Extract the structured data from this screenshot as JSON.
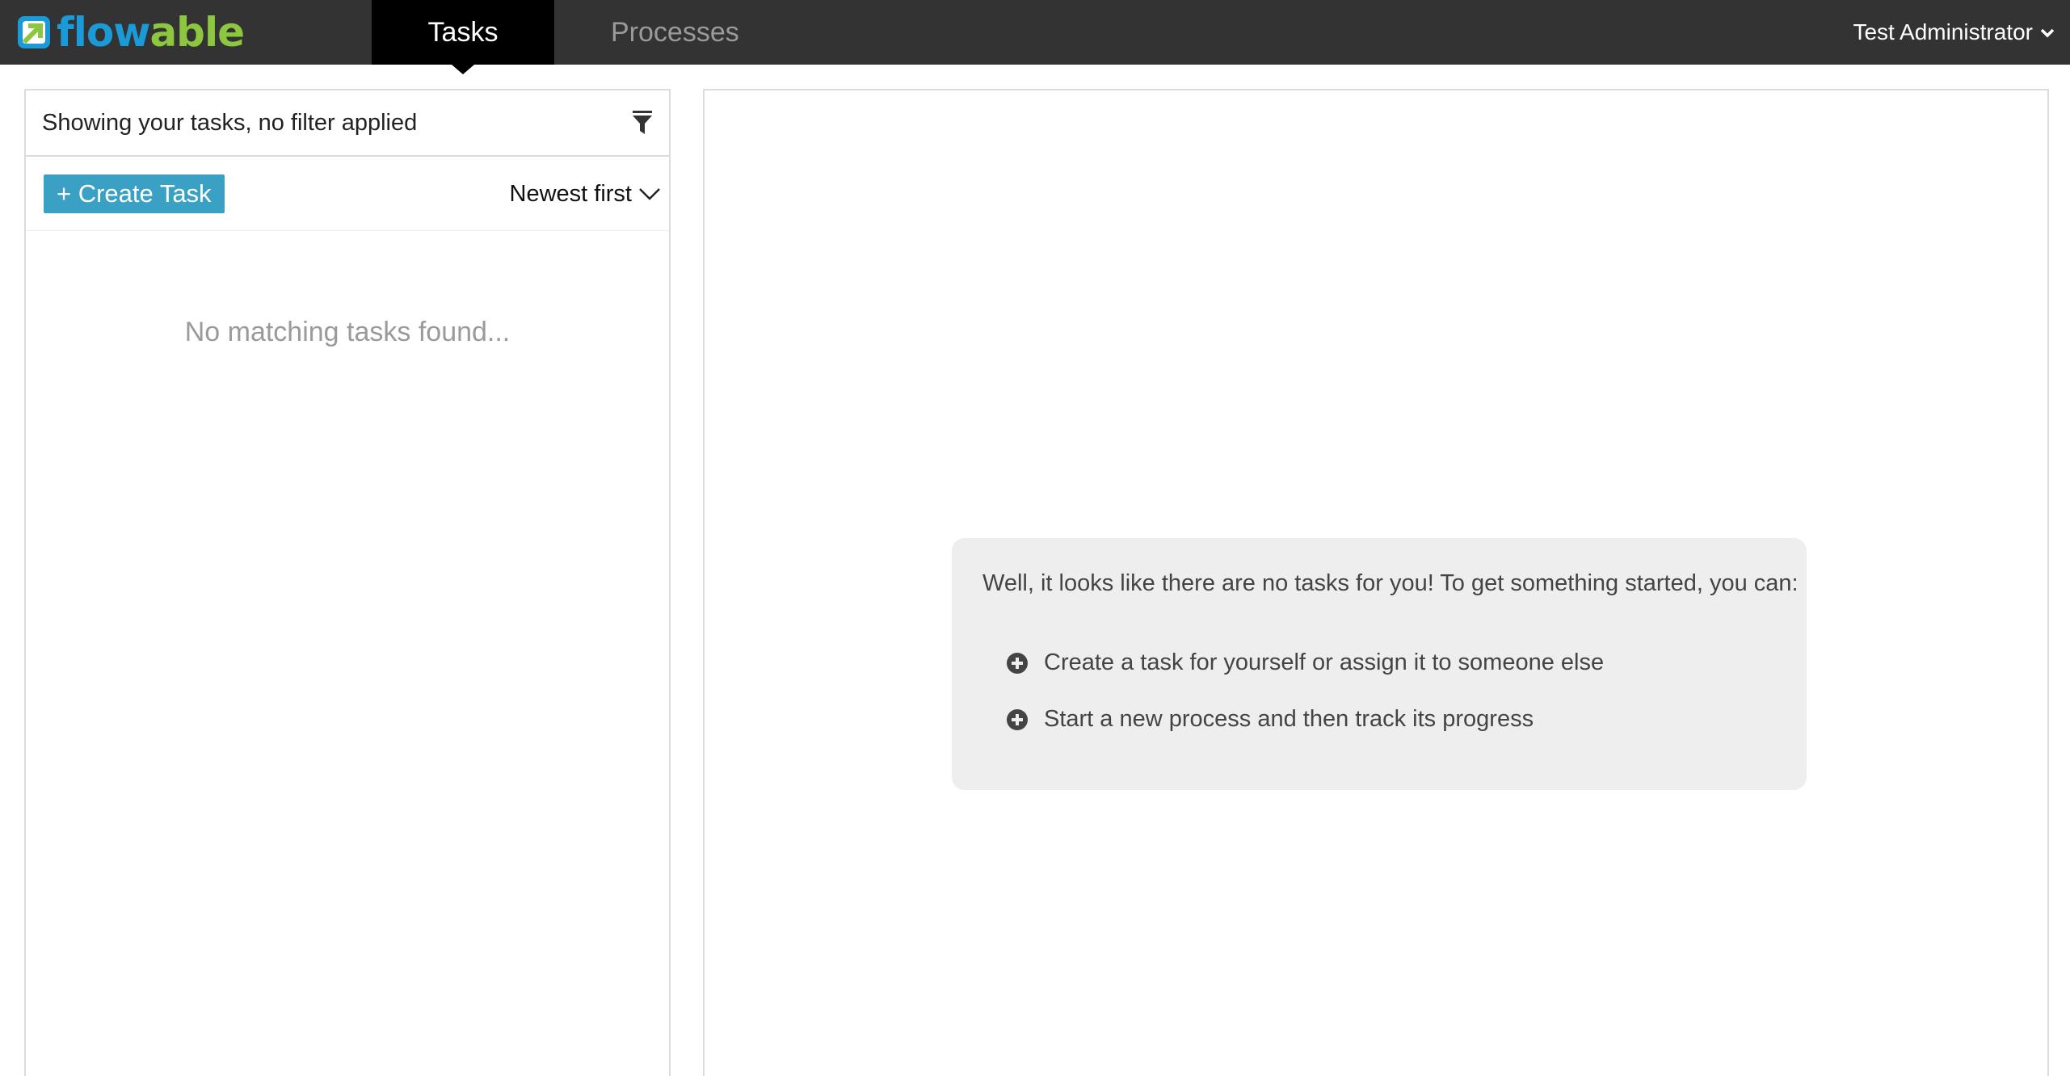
{
  "app": {
    "logo_text_part1": "flow",
    "logo_text_part2": "able",
    "logo_icon": "flowable-logo-icon"
  },
  "nav": {
    "tabs": [
      {
        "label": "Tasks",
        "active": true
      },
      {
        "label": "Processes",
        "active": false
      }
    ],
    "user": {
      "label": "Test Administrator",
      "icon": "chevron-down-icon"
    }
  },
  "task_list": {
    "filter_text": "Showing your tasks, no filter applied",
    "filter_icon": "filter-icon",
    "create_button_label": "+ Create Task",
    "sort_label": "Newest first",
    "sort_icon": "chevron-down-icon",
    "empty_message": "No matching tasks found..."
  },
  "detail": {
    "intro": "Well, it looks like there are no tasks for you! To get something started, you can:",
    "options": [
      {
        "label": "Create a task for yourself or assign it to someone else",
        "icon": "plus-circle-icon"
      },
      {
        "label": "Start a new process and then track its progress",
        "icon": "plus-circle-icon"
      }
    ]
  },
  "colors": {
    "topbar": "#333333",
    "active_tab": "#000000",
    "brand_blue": "#1a9bd7",
    "brand_green": "#8dc63f",
    "create_button": "#3aa1c4",
    "help_box": "#eeeeee"
  }
}
